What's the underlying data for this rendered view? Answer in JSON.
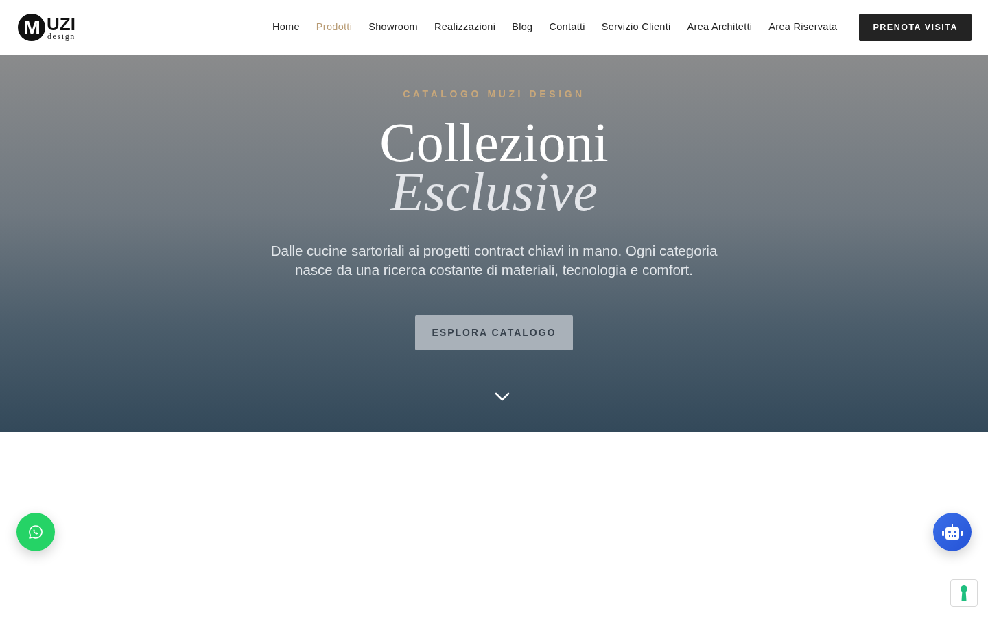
{
  "header": {
    "logo": {
      "initial": "M",
      "name": "UZI",
      "tagline": "design"
    },
    "nav": [
      {
        "label": "Home",
        "selected": false
      },
      {
        "label": "Prodotti",
        "selected": true
      },
      {
        "label": "Showroom",
        "selected": false
      },
      {
        "label": "Realizzazioni",
        "selected": false
      },
      {
        "label": "Blog",
        "selected": false
      },
      {
        "label": "Contatti",
        "selected": false
      },
      {
        "label": "Servizio Clienti",
        "selected": false
      },
      {
        "label": "Area Architetti",
        "selected": false
      },
      {
        "label": "Area Riservata",
        "selected": false
      }
    ],
    "cta": "PRENOTA VISITA"
  },
  "hero": {
    "eyebrow": "CATALOGO MUZI DESIGN",
    "title": "Collezioni",
    "title_italic": "Esclusive",
    "text": "Dalle cucine sartoriali ai progetti contract chiavi in mano. Ogni categoria nasce da una ricerca costante di materiali, tecnologia e comfort.",
    "button": "ESPLORA CATALOGO"
  },
  "floating_buttons": [
    {
      "kind": "whatsapp"
    },
    {
      "kind": "chatbot"
    },
    {
      "kind": "lock"
    }
  ]
}
